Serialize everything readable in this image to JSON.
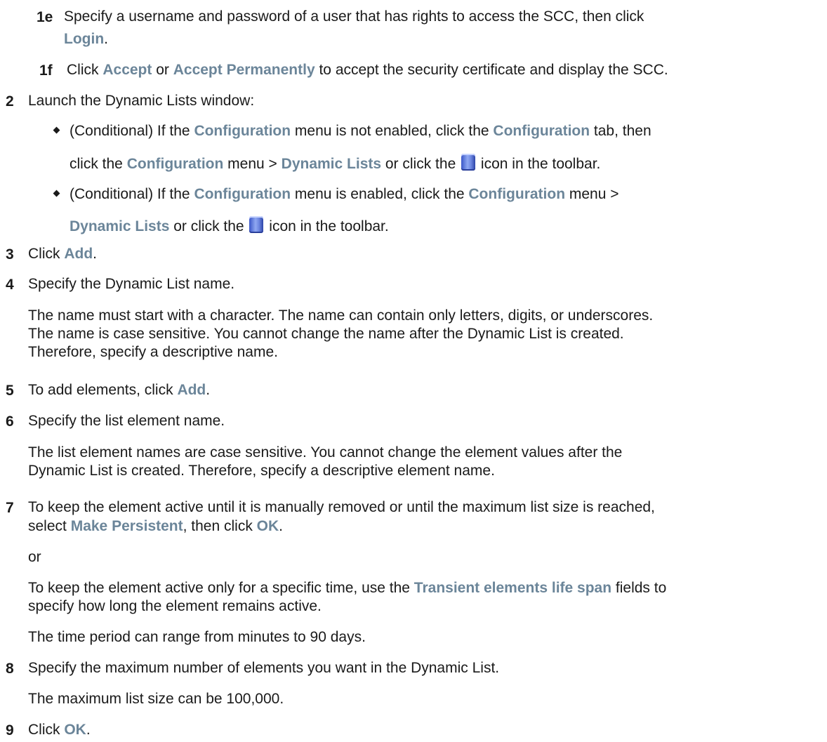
{
  "steps": {
    "s1e": {
      "num": "1e",
      "t1": "Specify a username and password of a user that has rights to access the SCC, then click",
      "ui1": "Login",
      "t2": "."
    },
    "s1f": {
      "num": "1f",
      "t1": "Click ",
      "ui1": "Accept",
      "t2": " or ",
      "ui2": "Accept Permanently",
      "t3": " to accept the security certificate and display the SCC."
    },
    "s2": {
      "num": "2",
      "t1": "Launch the Dynamic Lists window:"
    },
    "b1": {
      "t1": "(Conditional) If the ",
      "ui1": "Configuration",
      "t2": " menu is not enabled, click the ",
      "ui2": "Configuration",
      "t3": " tab, then",
      "t4": "click the ",
      "ui3": "Configuration",
      "t5": " menu > ",
      "ui4": "Dynamic Lists",
      "t6": " or click the ",
      "t7": " icon in the toolbar."
    },
    "b2": {
      "t1": "(Conditional) If the ",
      "ui1": "Configuration",
      "t2": " menu is enabled, click the ",
      "ui2": "Configuration",
      "t3": " menu >",
      "ui3": "Dynamic Lists",
      "t4": " or click the ",
      "t5": " icon in the toolbar."
    },
    "s3": {
      "num": "3",
      "t1": "Click ",
      "ui1": "Add",
      "t2": "."
    },
    "s4": {
      "num": "4",
      "t1": "Specify the Dynamic List name.",
      "p1": "The name must start with a character. The name can contain only letters, digits, or underscores.",
      "p2": "The name is case sensitive. You cannot change the name after the Dynamic List is created.",
      "p3": "Therefore, specify a descriptive name."
    },
    "s5": {
      "num": "5",
      "t1": "To add elements, click ",
      "ui1": "Add",
      "t2": "."
    },
    "s6": {
      "num": "6",
      "t1": "Specify the list element name.",
      "p1": "The list element names are case sensitive. You cannot change the element values after the",
      "p2": "Dynamic List is created. Therefore, specify a descriptive element name."
    },
    "s7": {
      "num": "7",
      "t1": "To keep the element active until it is manually removed or until the maximum list size is reached,",
      "t2": "select ",
      "ui1": "Make Persistent",
      "t3": ", then click ",
      "ui2": "OK",
      "t4": ".",
      "or": "or",
      "p1a": "To keep the element active only for a specific time, use the ",
      "p1ui": "Transient elements life span",
      "p1b": " fields to",
      "p2": "specify how long the element remains active.",
      "p3": "The time period can range from minutes to 90 days."
    },
    "s8": {
      "num": "8",
      "t1": "Specify the maximum number of elements you want in the Dynamic List.",
      "p1": "The maximum list size can be 100,000."
    },
    "s9": {
      "num": "9",
      "t1": "Click ",
      "ui1": "OK",
      "t2": "."
    }
  },
  "icons": {
    "toolbar_icon": "dynamic-lists-database-icon"
  }
}
